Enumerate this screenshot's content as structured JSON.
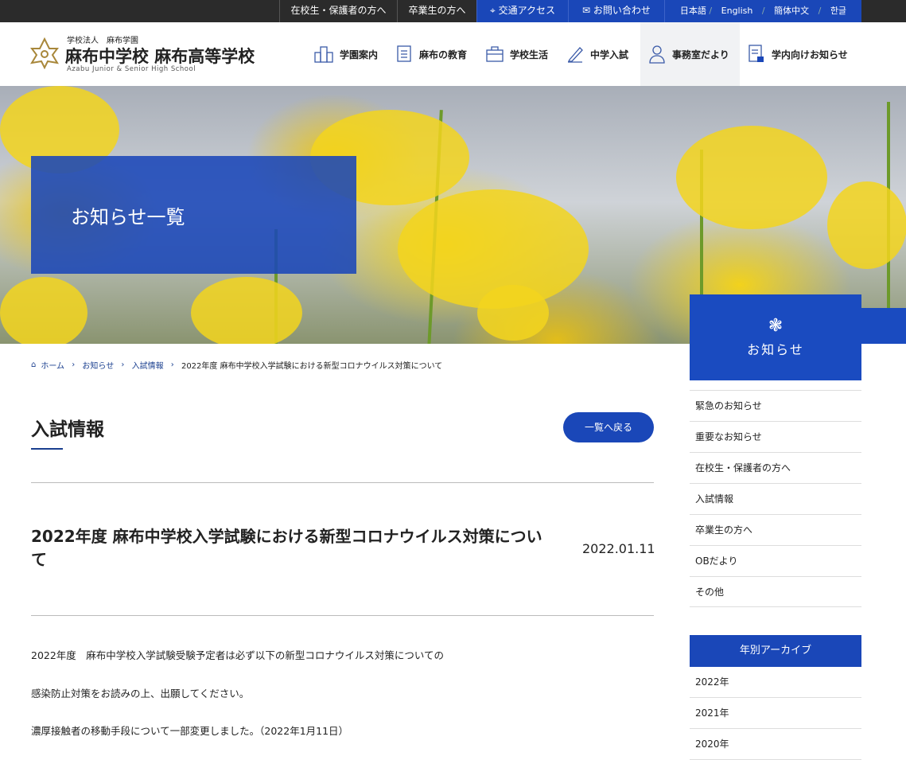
{
  "topbar": {
    "students": "在校生・保護者の方へ",
    "alumni": "卒業生の方へ",
    "access": "交通アクセス",
    "contact": "お問い合わせ",
    "langs": [
      "日本語",
      "English",
      "簡体中文",
      "한글"
    ]
  },
  "logo": {
    "sub": "学校法人　麻布学園",
    "main": "麻布中学校 麻布高等学校",
    "en": "Azabu Junior & Senior High School"
  },
  "nav": [
    "学園案内",
    "麻布の教育",
    "学校生活",
    "中学入試",
    "事務室だより",
    "学内向けお知らせ"
  ],
  "hero": {
    "title": "お知らせ一覧"
  },
  "breadcrumb": {
    "home": "ホーム",
    "news": "お知らせ",
    "exam": "入試情報",
    "current": "2022年度 麻布中学校入学試験における新型コロナウイルス対策について"
  },
  "section": {
    "title": "入試情報",
    "back": "一覧へ戻る"
  },
  "article": {
    "title": "2022年度 麻布中学校入学試験における新型コロナウイルス対策について",
    "date": "2022.01.11",
    "paragraphs": [
      "2022年度　麻布中学校入学試験受験予定者は必ず以下の新型コロナウイルス対策についての",
      "感染防止対策をお読みの上、出願してください。",
      "濃厚接触者の移動手段について一部変更しました。（2022年1月11日）"
    ]
  },
  "sidebar": {
    "heading": "お知らせ",
    "categories": [
      "緊急のお知らせ",
      "重要なお知らせ",
      "在校生・保護者の方へ",
      "入試情報",
      "卒業生の方へ",
      "OBだより",
      "その他"
    ],
    "archive_heading": "年別アーカイブ",
    "years": [
      "2022年",
      "2021年",
      "2020年"
    ]
  }
}
